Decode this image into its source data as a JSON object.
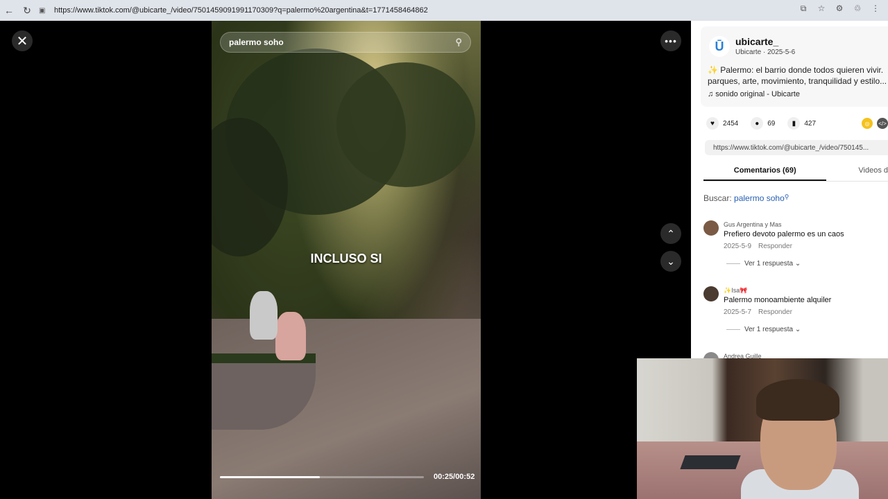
{
  "browser": {
    "url": "https://www.tiktok.com/@ubicarte_/video/7501459091991170309?q=palermo%20argentina&t=1771458464862",
    "back_icon": "back-arrow-icon",
    "reload_icon": "reload-icon"
  },
  "video": {
    "search_text": "palermo soho",
    "caption": "INCLUSO SI",
    "timecode": "00:25/00:52",
    "progress": 0.49
  },
  "author": {
    "logo_letter": "Ū",
    "username": "ubicarte_",
    "subline": "Ubicarte · 2025-5-6",
    "description": "✨ Palermo: el barrio donde todos quieren vivir. parques, arte, movimiento, tranquilidad y estilo...",
    "sound": "♫ sonido original - Ubicarte"
  },
  "stats": {
    "likes": "2454",
    "comments": "69",
    "saves": "427"
  },
  "link": "https://www.tiktok.com/@ubicarte_/video/750145...",
  "tabs": {
    "comments": "Comentarios (69)",
    "videos": "Videos d"
  },
  "buscar": {
    "label": "Buscar:",
    "keyword": "palermo soho"
  },
  "comments": [
    {
      "name": "Gus Argentina y Mas",
      "text": "Prefiero devoto palermo es un caos",
      "date": "2025-5-9",
      "reply": "Responder",
      "more": "Ver 1 respuesta ⌄"
    },
    {
      "name": "✨Isa🎀",
      "text": "Palermo monoambiente alquiler",
      "date": "2025-5-7",
      "reply": "Responder",
      "more": "Ver 1 respuesta ⌄"
    },
    {
      "name": "Andrea Guille"
    }
  ]
}
